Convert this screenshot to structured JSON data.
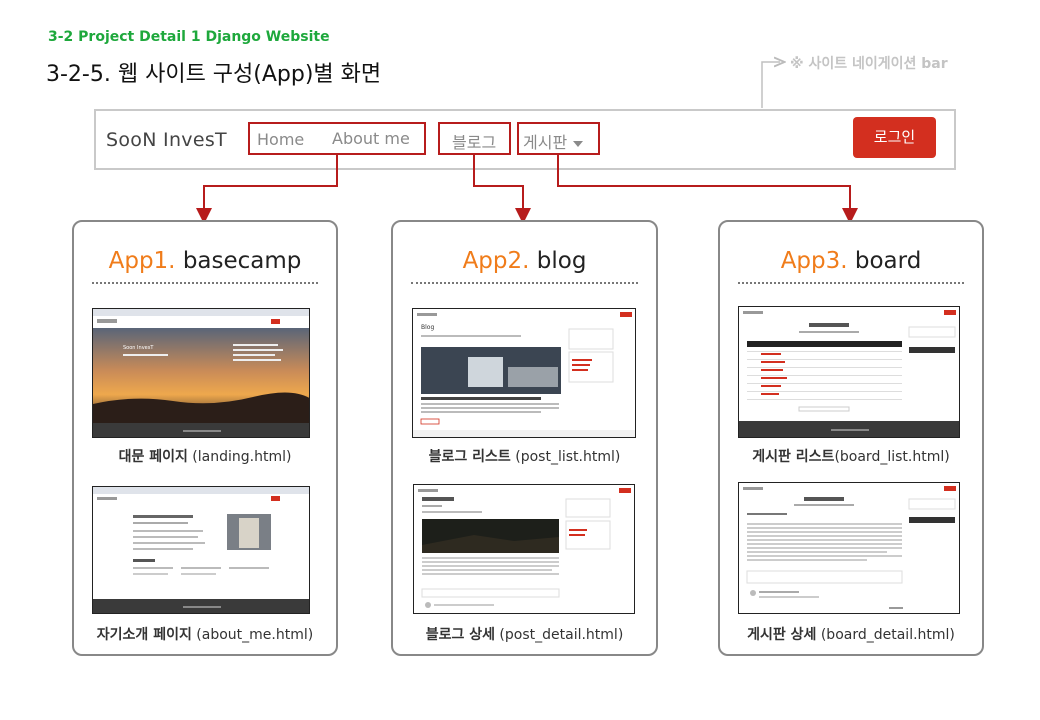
{
  "header": {
    "subtitle": "3-2 Project Detail 1 Django Website",
    "title": "3-2-5. 웹 사이트 구성(App)별 화면",
    "nav_note": "※ 사이트 네이게이션 bar"
  },
  "navbar": {
    "brand": "SooN InvesT",
    "home": "Home",
    "about": "About me",
    "blog": "블로그",
    "board": "게시판",
    "login": "로그인"
  },
  "apps": [
    {
      "num": "App1.",
      "name": "basecamp",
      "pages": [
        {
          "bold": "대문 페이지",
          "file": " (landing.html)"
        },
        {
          "bold": "자기소개 페이지",
          "file": " (about_me.html)"
        }
      ]
    },
    {
      "num": "App2.",
      "name": "blog",
      "pages": [
        {
          "bold": "블로그 리스트",
          "file": " (post_list.html)"
        },
        {
          "bold": "블로그 상세",
          "file": " (post_detail.html)"
        }
      ]
    },
    {
      "num": "App3.",
      "name": "board",
      "pages": [
        {
          "bold": "게시판 리스트",
          "file": "(board_list.html)"
        },
        {
          "bold": "게시판 상세",
          "file": " (board_detail.html)"
        }
      ]
    }
  ],
  "thumbs": {
    "landing_brand": "Soon InvesT",
    "blog_heading": "Blog"
  },
  "colors": {
    "accent_orange": "#f07c1a",
    "nav_red": "#b71c1c",
    "login_red": "#d32f1f",
    "subtitle_green": "#1ea83c"
  }
}
